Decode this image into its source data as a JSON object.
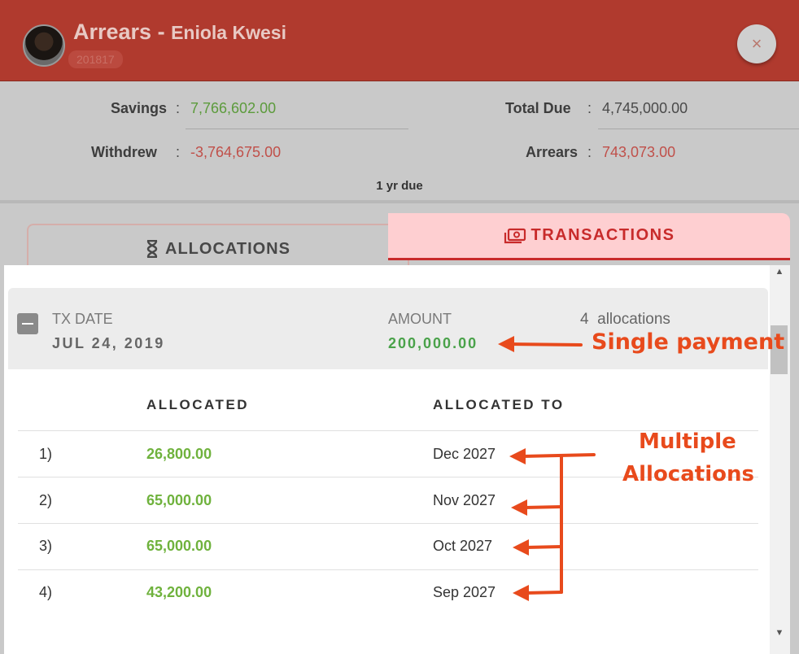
{
  "dialog": {
    "title": "Arrears",
    "dash": " - ",
    "student_name": "Eniola Kwesi",
    "student_id": "201817",
    "close_glyph": "×"
  },
  "summary": {
    "savings_label": "Savings",
    "savings_value": "7,766,602.00",
    "withdrew_label": "Withdrew",
    "withdrew_value": "-3,764,675.00",
    "total_due_label": "Total Due",
    "total_due_value": "4,745,000.00",
    "arrears_label": "Arrears",
    "arrears_value": "743,073.00",
    "separator": " : ",
    "due_note": "1 yr due"
  },
  "tabs": {
    "allocations": "ALLOCATIONS",
    "transactions": "TRANSACTIONS",
    "active": "transactions"
  },
  "transaction": {
    "date_label": "TX DATE",
    "date_value": "JUL 24, 2019",
    "amount_label": "AMOUNT",
    "amount_value": "200,000.00",
    "allocations_count": "4",
    "allocations_word": "allocations"
  },
  "table": {
    "headers": [
      "ALLOCATED",
      "ALLOCATED TO"
    ],
    "rows": [
      {
        "index": "1)",
        "allocated": "26,800.00",
        "allocated_to": "Dec 2027"
      },
      {
        "index": "2)",
        "allocated": "65,000.00",
        "allocated_to": "Nov 2027"
      },
      {
        "index": "3)",
        "allocated": "65,000.00",
        "allocated_to": "Oct 2027"
      },
      {
        "index": "4)",
        "allocated": "43,200.00",
        "allocated_to": "Sep 2027"
      }
    ]
  },
  "annotations": {
    "single_payment": "Single payment",
    "multiple_line1": "Multiple",
    "multiple_line2": "Allocations",
    "color": "#e84a1c"
  },
  "icons": {
    "close": "close-icon",
    "allocations": "hourglass-icon",
    "transactions": "money-icon",
    "collapse": "minus-square-icon"
  }
}
